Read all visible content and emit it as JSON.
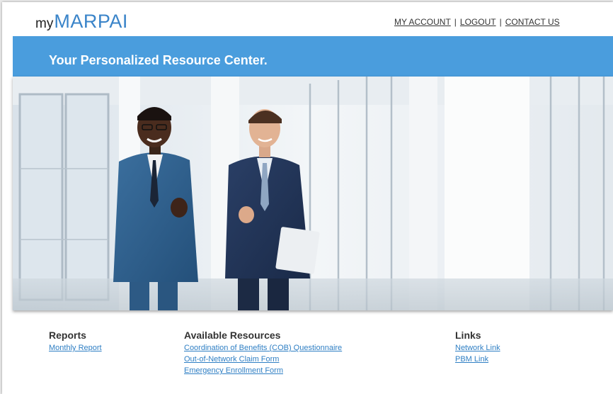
{
  "header": {
    "logo_prefix": "my",
    "logo_brand": "MARPAI",
    "nav": [
      {
        "label": "MY ACCOUNT"
      },
      {
        "label": "LOGOUT"
      },
      {
        "label": "CONTACT US"
      }
    ],
    "nav_separator": "|"
  },
  "banner": {
    "title": "Your Personalized Resource Center."
  },
  "sections": {
    "reports": {
      "heading": "Reports",
      "links": [
        "Monthly Report"
      ]
    },
    "resources": {
      "heading": "Available Resources",
      "links": [
        "Coordination of Benefits (COB) Questionnaire",
        "Out-of-Network Claim Form",
        "Emergency Enrollment Form"
      ]
    },
    "links": {
      "heading": "Links",
      "links": [
        "Network Link",
        "PBM Link"
      ]
    }
  },
  "colors": {
    "brand": "#3a84c9",
    "banner": "#4a9ddd",
    "link": "#2f7fc4"
  }
}
